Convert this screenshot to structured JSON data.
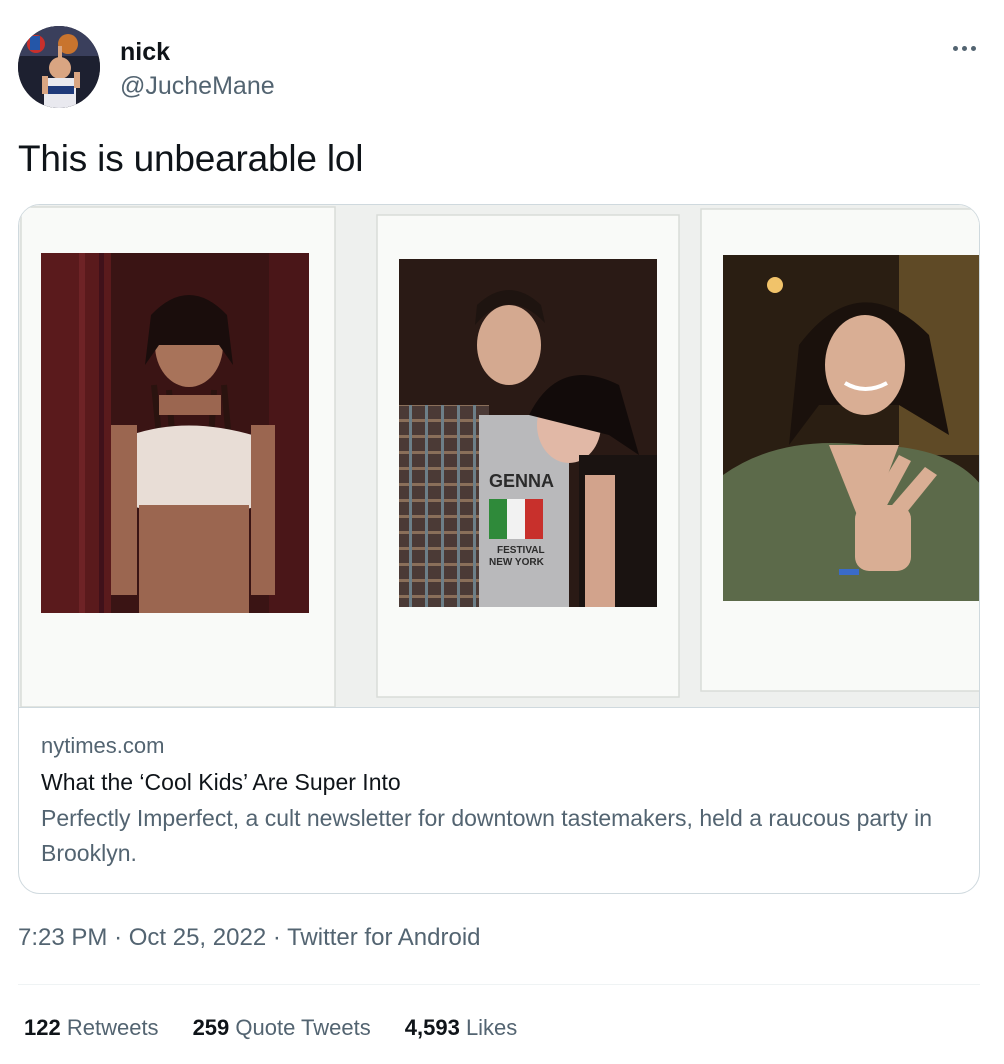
{
  "user": {
    "name": "nick",
    "handle": "@JucheMane",
    "avatar_icon": "avatar-photo"
  },
  "more_icon": "more-horizontal-icon",
  "tweet": {
    "text": "This is unbearable lol"
  },
  "card": {
    "media_description_icon": "polaroid-photos",
    "domain": "nytimes.com",
    "title": "What the ‘Cool Kids’ Are Super Into",
    "description": "Perfectly Imperfect, a cult newsletter for downtown tastemakers, held a raucous party in Brooklyn."
  },
  "meta": {
    "time": "7:23 PM",
    "separator": "·",
    "date": "Oct 25, 2022",
    "source": "Twitter for Android"
  },
  "stats": {
    "retweets_count": "122",
    "retweets_label": "Retweets",
    "quotes_count": "259",
    "quotes_label": "Quote Tweets",
    "likes_count": "4,593",
    "likes_label": "Likes"
  },
  "photo_text": {
    "shirt_line1": "GENNA",
    "shirt_line2": "FESTIVAL",
    "shirt_line3": "NEW YORK"
  },
  "colors": {
    "text_primary": "#0f1419",
    "text_secondary": "#536471",
    "border": "#cfd9de"
  }
}
